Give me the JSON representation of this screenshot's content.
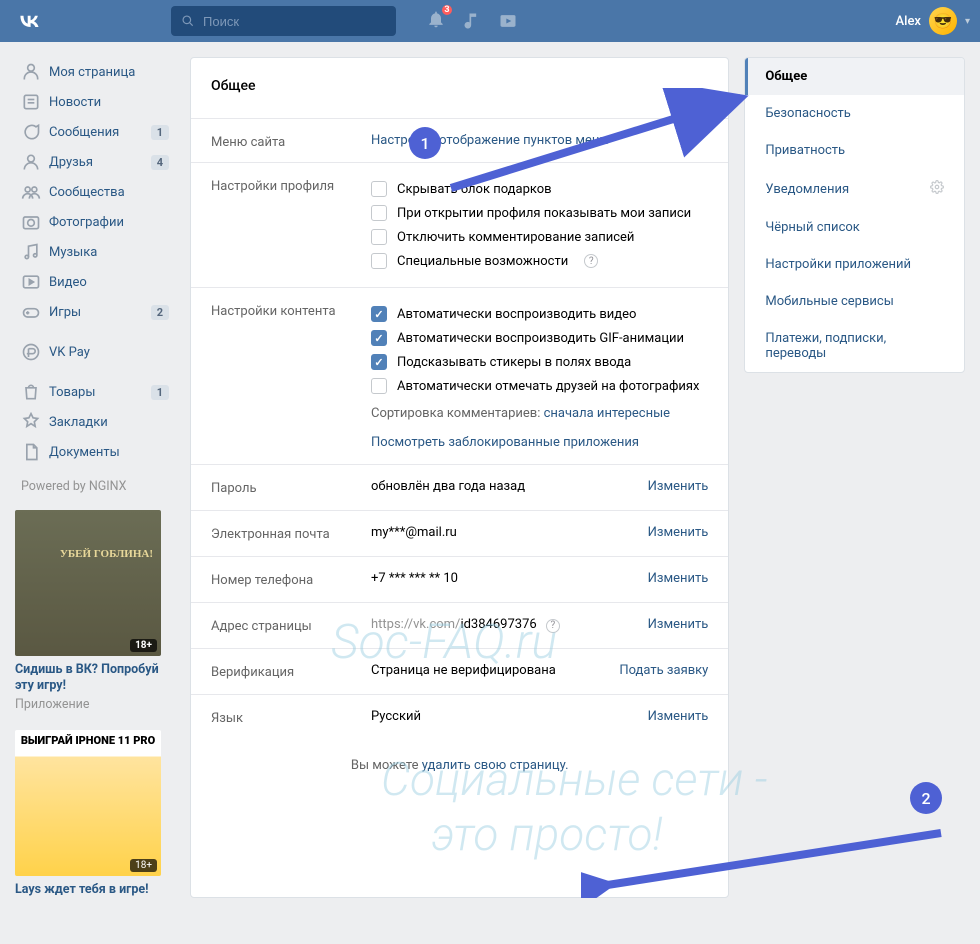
{
  "header": {
    "search_placeholder": "Поиск",
    "notif_count": "3",
    "user_name": "Alex"
  },
  "left_nav": [
    {
      "icon": "home",
      "label": "Моя страница",
      "count": ""
    },
    {
      "icon": "news",
      "label": "Новости",
      "count": ""
    },
    {
      "icon": "msg",
      "label": "Сообщения",
      "count": "1"
    },
    {
      "icon": "friends",
      "label": "Друзья",
      "count": "4"
    },
    {
      "icon": "groups",
      "label": "Сообщества",
      "count": ""
    },
    {
      "icon": "photos",
      "label": "Фотографии",
      "count": ""
    },
    {
      "icon": "music",
      "label": "Музыка",
      "count": ""
    },
    {
      "icon": "video",
      "label": "Видео",
      "count": ""
    },
    {
      "icon": "games",
      "label": "Игры",
      "count": "2"
    }
  ],
  "left_nav2": [
    {
      "icon": "pay",
      "label": "VK Pay",
      "count": ""
    }
  ],
  "left_nav3": [
    {
      "icon": "market",
      "label": "Товары",
      "count": "1"
    },
    {
      "icon": "bookmark",
      "label": "Закладки",
      "count": ""
    },
    {
      "icon": "docs",
      "label": "Документы",
      "count": ""
    }
  ],
  "powered": "Powered by NGINX",
  "ad1": {
    "title": "Сидишь в ВК? Попробуй эту игру!",
    "sub": "Приложение",
    "age": "18+",
    "banner": "УБЕЙ ГОБЛИНА!"
  },
  "ad2": {
    "age": "18+",
    "banner": "ВЫИГРАЙ IPHONE 11 PRO",
    "title": "Lays ждет тебя в игре!"
  },
  "main": {
    "title": "Общее",
    "menu_label": "Меню сайта",
    "menu_link": "Настроить отображение пунктов меню",
    "profile_label": "Настройки профиля",
    "profile_checks": [
      {
        "checked": false,
        "text": "Скрывать блок подарков"
      },
      {
        "checked": false,
        "text": "При открытии профиля показывать мои записи"
      },
      {
        "checked": false,
        "text": "Отключить комментирование записей"
      },
      {
        "checked": false,
        "text": "Специальные возможности",
        "help": true
      }
    ],
    "content_label": "Настройки контента",
    "content_checks": [
      {
        "checked": true,
        "text": "Автоматически воспроизводить видео"
      },
      {
        "checked": true,
        "text": "Автоматически воспроизводить GIF-анимации"
      },
      {
        "checked": true,
        "text": "Подсказывать стикеры в полях ввода"
      },
      {
        "checked": false,
        "text": "Автоматически отмечать друзей на фотографиях"
      }
    ],
    "sort_label": "Сортировка комментариев: ",
    "sort_value": "сначала интересные",
    "blocked_apps": "Посмотреть заблокированные приложения",
    "password_label": "Пароль",
    "password_value": "обновлён два года назад",
    "change": "Изменить",
    "email_label": "Электронная почта",
    "email_value": "my***@mail.ru",
    "phone_label": "Номер телефона",
    "phone_value": "+7 *** *** ** 10",
    "url_label": "Адрес страницы",
    "url_prefix": "https://vk.com/",
    "url_id": "id384697376",
    "verif_label": "Верификация",
    "verif_value": "Страница не верифицирована",
    "verif_action": "Подать заявку",
    "lang_label": "Язык",
    "lang_value": "Русский",
    "footer_prefix": "Вы можете ",
    "footer_link": "удалить свою страницу."
  },
  "tabs": [
    "Общее",
    "Безопасность",
    "Приватность",
    "Уведомления",
    "Чёрный список",
    "Настройки приложений",
    "Мобильные сервисы",
    "Платежи, подписки, переводы"
  ],
  "annotations": {
    "one": "1",
    "two": "2"
  },
  "watermark": {
    "l1": "Soc-FAQ.ru",
    "l2": "Социальные сети -",
    "l3": "это просто!"
  }
}
